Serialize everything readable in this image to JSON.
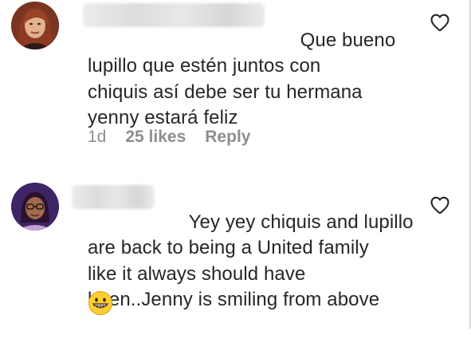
{
  "comments": [
    {
      "text_first": "Que bueno",
      "text_rest": "lupillo que estén juntos con\nchiquis así debe ser tu hermana\nyenny estará feliz",
      "time": "1d",
      "likes": "25 likes",
      "reply": "Reply",
      "avatar_icon": "user-avatar-woman-red-hair",
      "like_icon": "heart-outline-icon"
    },
    {
      "text_first": "Yey yey chiquis and lupillo",
      "text_rest": "are back to being a United family\nlike it always should have\nbeen..Jenny is smiling from above",
      "emoji": "grinning-face-emoji",
      "avatar_icon": "user-avatar-woman-glasses",
      "like_icon": "heart-outline-icon"
    }
  ],
  "colors": {
    "text": "#262626",
    "meta": "#8e8e8e",
    "blur": "#dedede"
  }
}
